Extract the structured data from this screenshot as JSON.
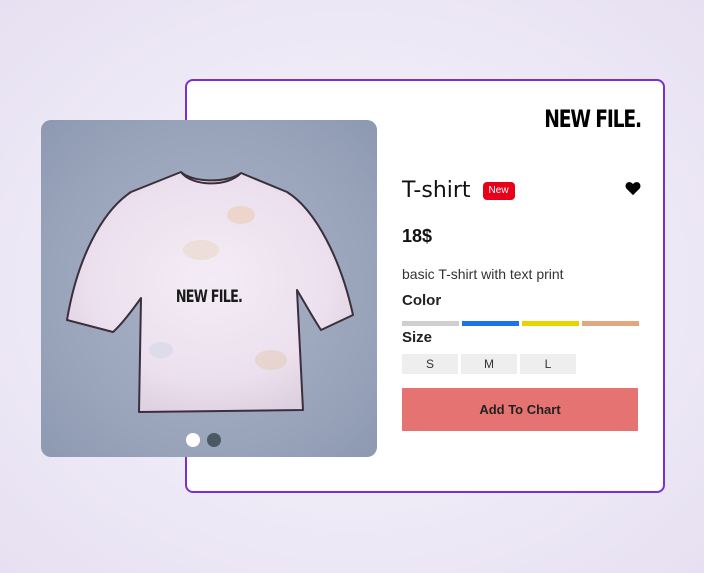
{
  "brand": "NEW FILE.",
  "product": {
    "title": "T-shirt",
    "badge": "New",
    "price": "18$",
    "description": "basic T-shirt with text print",
    "print_text": "NEW FILE."
  },
  "color_section": {
    "label": "Color",
    "options": [
      "#cfcfcf",
      "#1a73e8",
      "#e8d400",
      "#e0a881"
    ]
  },
  "size_section": {
    "label": "Size",
    "options": [
      "S",
      "M",
      "L"
    ]
  },
  "cta_label": "Add To Chart",
  "carousel": {
    "dot_colors": [
      "#ffffff",
      "#4a5a63"
    ]
  },
  "colors": {
    "accent_border": "#7b2fd0",
    "badge": "#e8001a",
    "cta": "#e57372"
  },
  "icons": {
    "favorite": "heart-icon"
  }
}
